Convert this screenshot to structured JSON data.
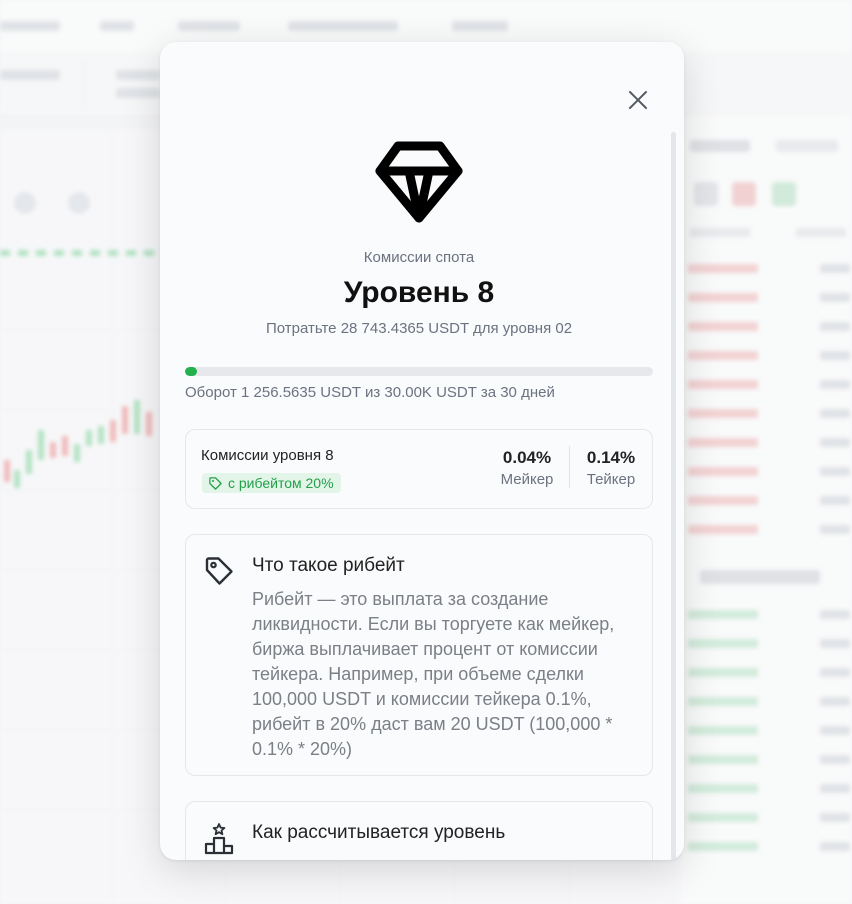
{
  "modal": {
    "subtitle": "Комиссии спота",
    "title": "Уровень 8",
    "next_level_text": "Потратьте 28 743.4365 USDT для уровня 02",
    "progress_percent": 2.5,
    "turnover_text": "Оборот 1 256.5635 USDT из 30.00K USDT за 30 дней",
    "fees": {
      "label": "Комиссии уровня 8",
      "rebate_badge": "с рибейтом 20%",
      "maker_value": "0.04%",
      "maker_label": "Мейкер",
      "taker_value": "0.14%",
      "taker_label": "Тейкер"
    },
    "rebate_info": {
      "title": "Что такое рибейт",
      "text": "Рибейт — это выплата за создание ликвидности. Если вы торгуете как мейкер, биржа выплачивает процент от комиссии тейкера. Например, при объеме сделки 100,000 USDT и комиссии тейкера 0.1%, рибейт в 20% даст вам 20 USDT (100,000 * 0.1% * 20%)"
    },
    "level_info": {
      "title": "Как рассчитывается уровень"
    },
    "colors": {
      "accent_green": "#22b14c",
      "badge_bg": "#e3f4e8",
      "badge_text": "#22a04a"
    },
    "icons": [
      "close-icon",
      "diamond-icon",
      "tag-icon",
      "podium-icon"
    ]
  }
}
